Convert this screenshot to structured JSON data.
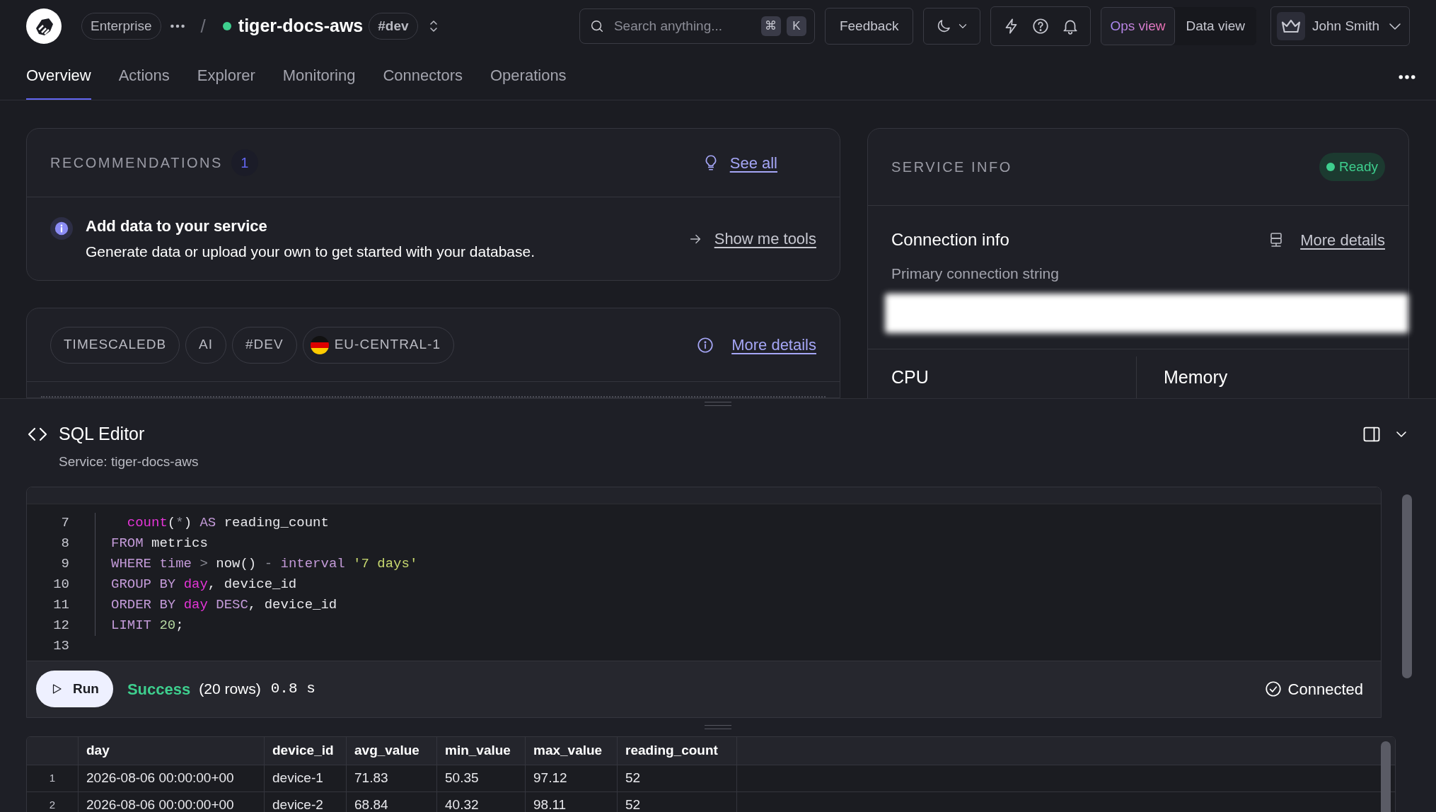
{
  "header": {
    "org": "Enterprise",
    "separator": "/",
    "service": "tiger-docs-aws",
    "env": "#dev",
    "search": {
      "placeholder": "Search anything...",
      "keys": [
        "⌘",
        "K"
      ]
    },
    "feedback": "Feedback",
    "views": [
      {
        "label": "Ops view",
        "selected": true
      },
      {
        "label": "Data view",
        "selected": false
      }
    ],
    "user": "John Smith"
  },
  "tabs": [
    {
      "label": "Overview",
      "selected": true
    },
    {
      "label": "Actions",
      "selected": false
    },
    {
      "label": "Explorer",
      "selected": false
    },
    {
      "label": "Monitoring",
      "selected": false
    },
    {
      "label": "Connectors",
      "selected": false
    },
    {
      "label": "Operations",
      "selected": false
    }
  ],
  "recommendations": {
    "title": "RECOMMENDATIONS",
    "count": "1",
    "see_all": "See all",
    "items": [
      {
        "title": "Add data to your service",
        "text": "Generate data or upload your own to get started with your database.",
        "action": "Show me tools"
      }
    ]
  },
  "service_tags": {
    "tags": [
      {
        "label": "TIMESCALEDB",
        "kind": "plain"
      },
      {
        "label": "AI",
        "kind": "plain"
      },
      {
        "label": "#DEV",
        "kind": "plain"
      },
      {
        "label": "EU-CENTRAL-1",
        "kind": "region"
      }
    ],
    "link": "More details"
  },
  "service_info": {
    "title": "SERVICE INFO",
    "status": "Ready",
    "connection_title": "Connection info",
    "link": "More details",
    "string_label": "Primary connection string",
    "metrics": [
      "CPU",
      "Memory"
    ]
  },
  "sql_editor": {
    "title": "SQL Editor",
    "subtitle": "Service: tiger-docs-aws",
    "lines": [
      {
        "number": "7",
        "tokens": [
          {
            "text": "  count",
            "kind": "fn"
          },
          {
            "text": "(",
            "kind": "plain"
          },
          {
            "text": "*",
            "kind": "op"
          },
          {
            "text": ") ",
            "kind": "plain"
          },
          {
            "text": "AS",
            "kind": "kw"
          },
          {
            "text": " reading_count",
            "kind": "plain"
          }
        ]
      },
      {
        "number": "8",
        "tokens": [
          {
            "text": "FROM",
            "kind": "kw"
          },
          {
            "text": " metrics",
            "kind": "plain"
          }
        ]
      },
      {
        "number": "9",
        "tokens": [
          {
            "text": "WHERE time",
            "kind": "kw"
          },
          {
            "text": " > ",
            "kind": "op"
          },
          {
            "text": "now() ",
            "kind": "plain"
          },
          {
            "text": "- ",
            "kind": "op"
          },
          {
            "text": "interval ",
            "kind": "kw"
          },
          {
            "text": "'7 days'",
            "kind": "str"
          }
        ]
      },
      {
        "number": "10",
        "tokens": [
          {
            "text": "GROUP BY ",
            "kind": "kw"
          },
          {
            "text": "day",
            "kind": "fn"
          },
          {
            "text": ", device_id",
            "kind": "plain"
          }
        ]
      },
      {
        "number": "11",
        "tokens": [
          {
            "text": "ORDER BY ",
            "kind": "kw"
          },
          {
            "text": "day ",
            "kind": "fn"
          },
          {
            "text": "DESC",
            "kind": "kw"
          },
          {
            "text": ", device_id",
            "kind": "plain"
          }
        ]
      },
      {
        "number": "12",
        "tokens": [
          {
            "text": "LIMIT ",
            "kind": "kw"
          },
          {
            "text": "20",
            "kind": "num"
          },
          {
            "text": ";",
            "kind": "plain"
          }
        ]
      },
      {
        "number": "13"
      }
    ],
    "run": "Run",
    "result": {
      "status": "Success",
      "rows": "(20 rows)",
      "time": "0.8 s"
    },
    "connection": "Connected"
  },
  "results": {
    "columns": [
      "day",
      "device_id",
      "avg_value",
      "min_value",
      "max_value",
      "reading_count"
    ],
    "rows": [
      {
        "index": "1",
        "cells": [
          "2026-08-06 00:00:00+00",
          "device-1",
          "71.83",
          "50.35",
          "97.12",
          "52"
        ]
      },
      {
        "index": "2",
        "cells": [
          "2026-08-06 00:00:00+00",
          "device-2",
          "68.84",
          "40.32",
          "98.11",
          "52"
        ]
      }
    ]
  }
}
